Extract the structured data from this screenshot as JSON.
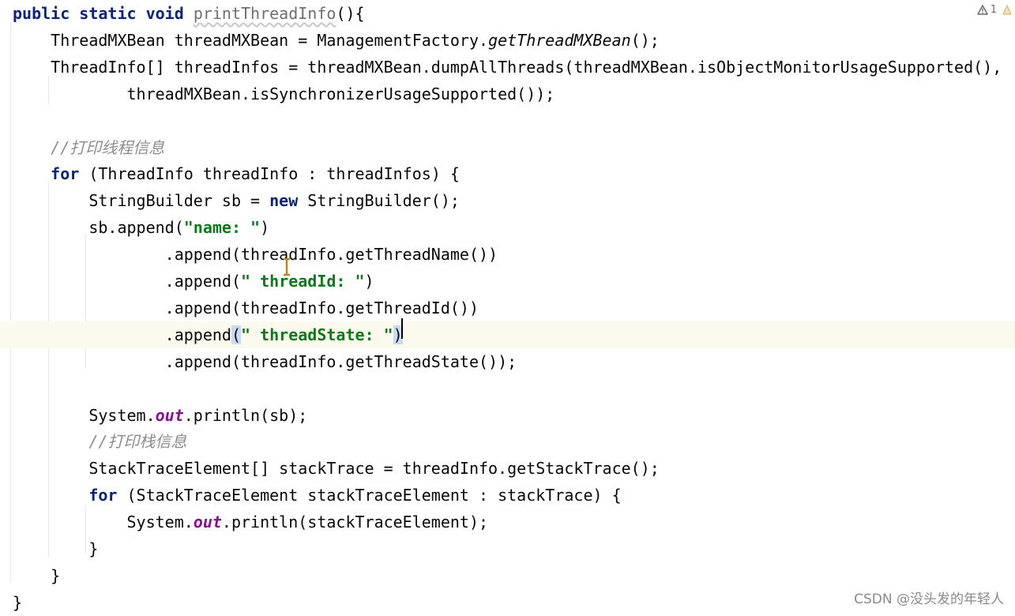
{
  "editor": {
    "lines": [
      {
        "tokens": [
          {
            "t": "public",
            "c": "kw"
          },
          {
            "t": " "
          },
          {
            "t": "static",
            "c": "kw"
          },
          {
            "t": " "
          },
          {
            "t": "void",
            "c": "kw"
          },
          {
            "t": " "
          },
          {
            "t": "printThreadInfo",
            "c": "method-unused squiggle"
          },
          {
            "t": "(){"
          }
        ]
      },
      {
        "tokens": [
          {
            "t": "    ThreadMXBean threadMXBean = ManagementFactory."
          },
          {
            "t": "getThreadMXBean",
            "c": "italic"
          },
          {
            "t": "();"
          }
        ]
      },
      {
        "tokens": [
          {
            "t": "    ThreadInfo[] threadInfos = threadMXBean.dumpAllThreads(threadMXBean.isObjectMonitorUsageSupported(),"
          }
        ]
      },
      {
        "tokens": [
          {
            "t": "            threadMXBean.isSynchronizerUsageSupported());"
          }
        ]
      },
      {
        "tokens": []
      },
      {
        "tokens": [
          {
            "t": "    "
          },
          {
            "t": "//打印线程信息",
            "c": "comment"
          }
        ]
      },
      {
        "tokens": [
          {
            "t": "    "
          },
          {
            "t": "for",
            "c": "kw"
          },
          {
            "t": " (ThreadInfo threadInfo : threadInfos) {"
          }
        ]
      },
      {
        "tokens": [
          {
            "t": "        StringBuilder sb = "
          },
          {
            "t": "new",
            "c": "kw"
          },
          {
            "t": " StringBuilder();"
          }
        ]
      },
      {
        "tokens": [
          {
            "t": "        sb.append("
          },
          {
            "t": "\"name: \"",
            "c": "str"
          },
          {
            "t": ")"
          }
        ]
      },
      {
        "tokens": [
          {
            "t": "                .append(threadInfo.getThreadName())"
          }
        ]
      },
      {
        "tokens": [
          {
            "t": "                .append("
          },
          {
            "t": "\" threadId: \"",
            "c": "str"
          },
          {
            "t": ")"
          }
        ]
      },
      {
        "tokens": [
          {
            "t": "                .append(threadInfo.getThreadId())"
          }
        ]
      },
      {
        "highlight": true,
        "tokens": [
          {
            "t": "                .append"
          },
          {
            "t": "(",
            "c": "brace-match"
          },
          {
            "t": "\" threadState: \"",
            "c": "str"
          },
          {
            "t": ")",
            "c": "brace-match"
          }
        ]
      },
      {
        "tokens": [
          {
            "t": "                .append(threadInfo.getThreadState());"
          }
        ]
      },
      {
        "tokens": []
      },
      {
        "tokens": [
          {
            "t": "        System."
          },
          {
            "t": "out",
            "c": "field"
          },
          {
            "t": ".println(sb);"
          }
        ]
      },
      {
        "tokens": [
          {
            "t": "        "
          },
          {
            "t": "//打印栈信息",
            "c": "comment"
          }
        ]
      },
      {
        "tokens": [
          {
            "t": "        StackTraceElement[] stackTrace = threadInfo.getStackTrace();"
          }
        ]
      },
      {
        "tokens": [
          {
            "t": "        "
          },
          {
            "t": "for",
            "c": "kw"
          },
          {
            "t": " (StackTraceElement stackTraceElement : stackTrace) {"
          }
        ]
      },
      {
        "tokens": [
          {
            "t": "            System."
          },
          {
            "t": "out",
            "c": "field"
          },
          {
            "t": ".println(stackTraceElement);"
          }
        ]
      },
      {
        "tokens": [
          {
            "t": "        }"
          }
        ]
      },
      {
        "tokens": [
          {
            "t": "    }"
          }
        ]
      },
      {
        "tokens": [
          {
            "t": "}"
          }
        ]
      }
    ]
  },
  "inspections": {
    "icon": "warning-icon",
    "count": "1",
    "color": "#6a6a6a"
  },
  "watermark": {
    "text": "CSDN @没头发的年轻人"
  },
  "colors": {
    "keyword": "#0a2280",
    "string": "#067d17",
    "comment": "#8c8c8c",
    "static_field": "#871094",
    "current_line": "#fcfaed",
    "brace_match": "#c6dcf6"
  }
}
